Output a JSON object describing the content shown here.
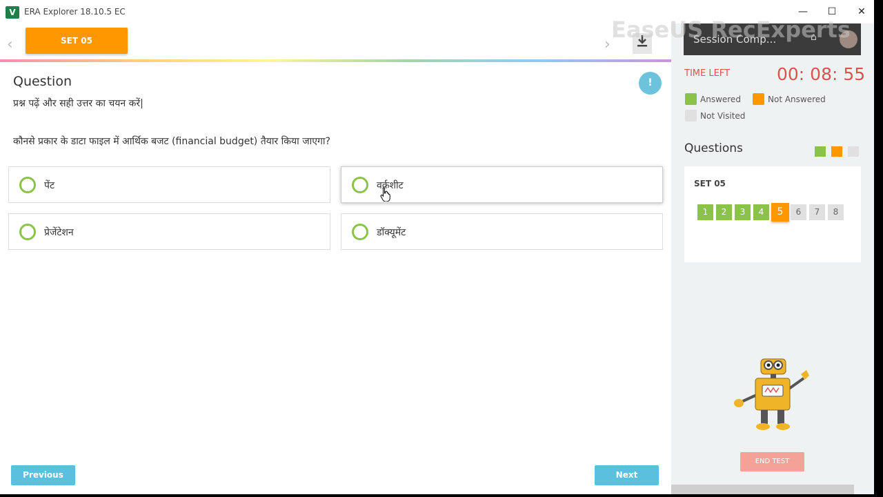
{
  "window": {
    "app_title": "ERA Explorer 18.10.5 EC",
    "controls": {
      "minimize": "—",
      "maximize": "☐",
      "close": "✕"
    }
  },
  "toolbar": {
    "set_label": "SET 05",
    "prev_arrow": "‹",
    "next_arrow": "›",
    "download_icon": "download-icon"
  },
  "question": {
    "heading": "Question",
    "info_label": "!",
    "instruction": "प्रश्न पढ़ें और सही उत्तर का चयन करें|",
    "text": "कौनसे प्रकार के डाटा फाइल में आर्थिक बजट (financial budget) तैयार किया जाएगा?",
    "options": [
      {
        "label": "पेंट",
        "selected": false
      },
      {
        "label": "वर्कशीट",
        "selected": true
      },
      {
        "label": "प्रेजेंटेशन",
        "selected": false
      },
      {
        "label": "डॉक्यूमेंट",
        "selected": false
      }
    ]
  },
  "footer": {
    "previous": "Previous",
    "next": "Next"
  },
  "sidebar": {
    "session_title": "Session Comp...",
    "watermark": "EaseUS RecExperts",
    "time_left_label": "TIME LEFT",
    "timer": "00: 08: 55",
    "legend": {
      "answered": "Answered",
      "not_answered": "Not Answered",
      "not_visited": "Not Visited"
    },
    "questions_heading": "Questions",
    "set_title": "SET 05",
    "question_numbers": [
      {
        "n": "1",
        "state": "answered"
      },
      {
        "n": "2",
        "state": "answered"
      },
      {
        "n": "3",
        "state": "answered"
      },
      {
        "n": "4",
        "state": "answered"
      },
      {
        "n": "5",
        "state": "current"
      },
      {
        "n": "6",
        "state": "not-visited"
      },
      {
        "n": "7",
        "state": "not-visited"
      },
      {
        "n": "8",
        "state": "not-visited"
      }
    ],
    "end_test": "END TEST"
  },
  "colors": {
    "orange": "#ff9800",
    "green": "#8bc34a",
    "grey": "#e0e0e0",
    "timer_red": "#d9534f",
    "button_blue": "#5bc0de"
  }
}
